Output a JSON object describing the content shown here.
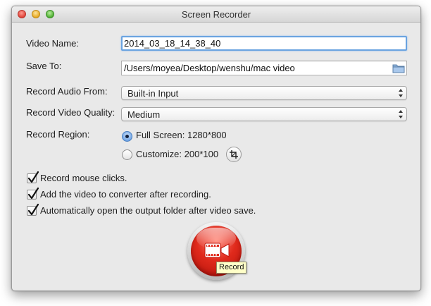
{
  "window": {
    "title": "Screen Recorder"
  },
  "form": {
    "video_name": {
      "label": "Video Name:",
      "value": "2014_03_18_14_38_40"
    },
    "save_to": {
      "label": "Save To:",
      "value": "/Users/moyea/Desktop/wenshu/mac video"
    },
    "audio": {
      "label": "Record Audio From:",
      "selected": "Built-in Input"
    },
    "quality": {
      "label": "Record Video Quality:",
      "selected": "Medium"
    },
    "region": {
      "label": "Record Region:",
      "full_screen": {
        "label": "Full Screen: 1280*800",
        "selected": true
      },
      "customize": {
        "label": "Customize: 200*100",
        "selected": false
      }
    }
  },
  "options": [
    {
      "label": "Record mouse clicks.",
      "checked": true
    },
    {
      "label": "Add the video to converter after recording.",
      "checked": true
    },
    {
      "label": "Automatically open the output folder after video save.",
      "checked": true
    }
  ],
  "record": {
    "tooltip": "Record"
  },
  "colors": {
    "accent_blue": "#6aa3e0",
    "record_red": "#e02a1c",
    "tooltip_bg": "#ffffc8"
  },
  "icons": {
    "close": "close-icon",
    "minimize": "minimize-icon",
    "zoom": "zoom-icon",
    "folder": "folder-icon",
    "updown": "updown-arrows-icon",
    "crop": "crop-icon",
    "checkmark": "checkmark-icon",
    "camera": "video-camera-icon"
  }
}
